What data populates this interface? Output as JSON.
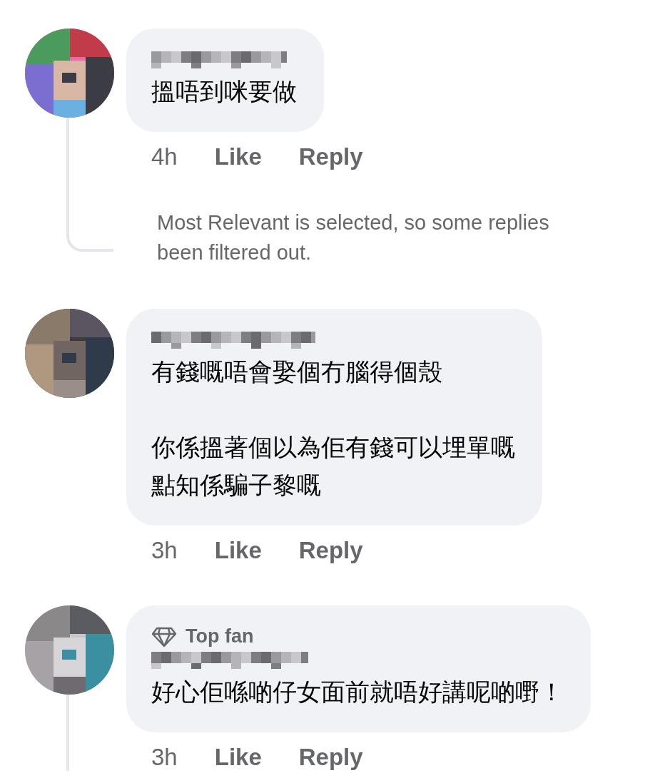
{
  "comments": [
    {
      "paragraphs": [
        [
          "搵唔到咪要做"
        ]
      ],
      "time": "4h",
      "actions": [
        "Like",
        "Reply"
      ],
      "thread_line": true,
      "note": [
        "Most Relevant is selected, so some replies",
        "been filtered out."
      ]
    },
    {
      "paragraphs": [
        [
          "有錢嘅唔會娶個冇腦得個殼"
        ],
        [
          "你係搵著個以為佢有錢可以埋單嘅",
          "點知係騙子黎嘅"
        ]
      ],
      "time": "3h",
      "actions": [
        "Like",
        "Reply"
      ],
      "thread_line": false
    },
    {
      "badge": "Top fan",
      "paragraphs": [
        [
          "好心佢喺啲仔女面前就唔好講呢啲嘢！"
        ]
      ],
      "time": "3h",
      "actions": [
        "Like",
        "Reply"
      ],
      "thread_line": true
    }
  ]
}
